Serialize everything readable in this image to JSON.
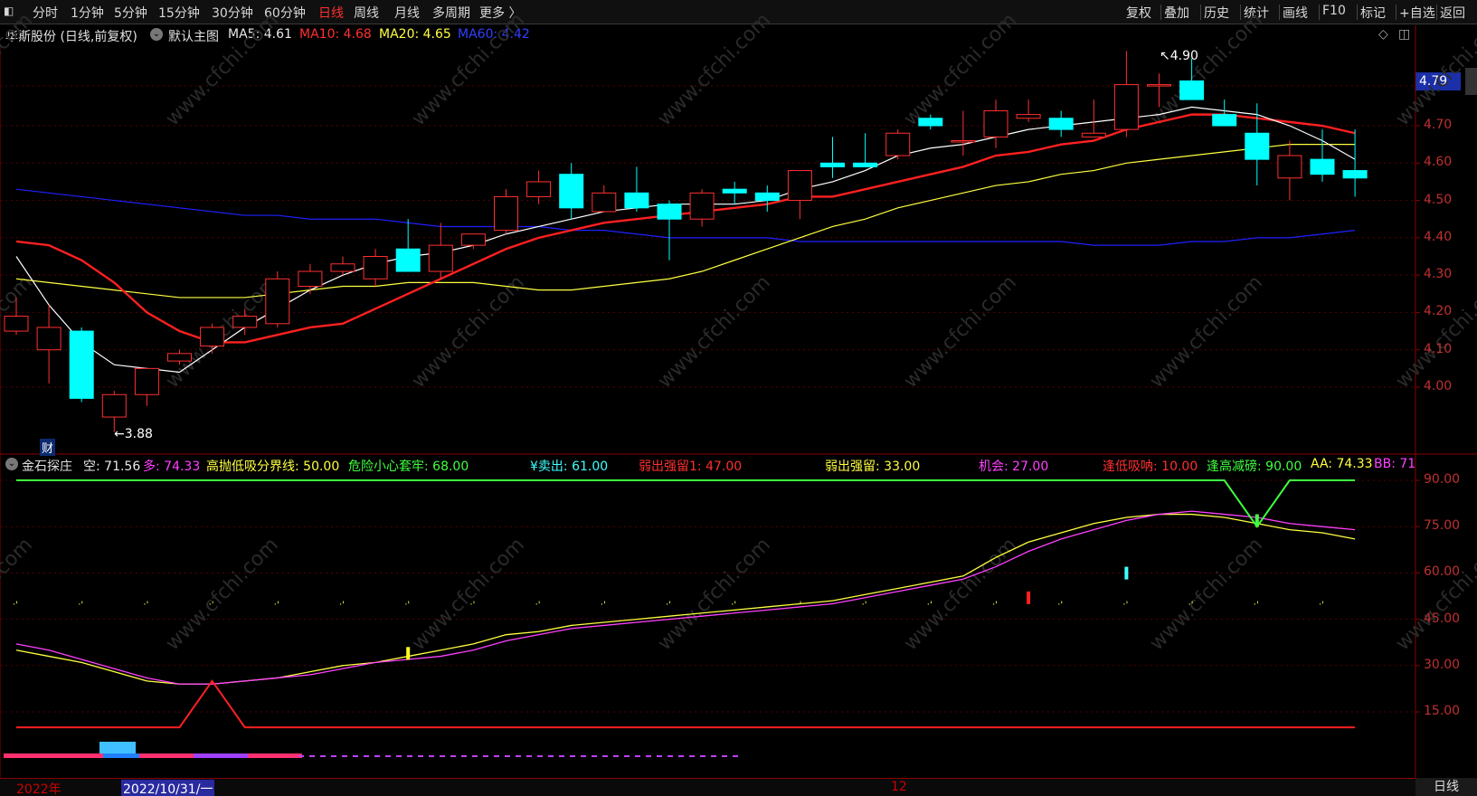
{
  "toolbar": {
    "left_items": [
      "分时",
      "1分钟",
      "5分钟",
      "15分钟",
      "30分钟",
      "60分钟",
      "日线",
      "周线",
      "月线",
      "多周期",
      "更多 〉"
    ],
    "active_item": "日线",
    "right_items": [
      "复权",
      "叠加",
      "历史",
      "统计",
      "画线",
      "F10",
      "标记",
      "+自选",
      "返回"
    ]
  },
  "main_chart": {
    "stock_title": "华斯股份 (日线,前复权)",
    "template_label": "默认主图",
    "ma5": "MA5: 4.61",
    "ma10": "MA10: 4.68",
    "ma20": "MA20: 4.65",
    "ma60": "MA60: 4.42",
    "current_price": "4.79",
    "high_marker": "4.90",
    "low_marker": "←3.88",
    "finance_marker": "财",
    "y_ticks": [
      "4.70",
      "4.60",
      "4.50",
      "4.40",
      "4.30",
      "4.20",
      "4.10",
      "4.00"
    ],
    "colors": {
      "ma5": "#ffffff",
      "ma10": "#ff2020",
      "ma20": "#ffff40",
      "ma60": "#2020ff",
      "up": "#ff3030",
      "down": "#00ffff"
    }
  },
  "indicator": {
    "name": "金石探庄",
    "kong": "空: 71.56",
    "duo": "多: 74.33",
    "line1": "高抛低吸分界线: 50.00",
    "line2": "危险小心套牢: 68.00",
    "line3": "¥卖出: 61.00",
    "line4": "弱出强留1: 47.00",
    "line5": "弱出强留: 33.00",
    "line6": "机会: 27.00",
    "line7": "逢低吸呐: 10.00",
    "line8": "逢高减磅: 90.00",
    "line9": "AA: 74.33",
    "line10": "BB: 71",
    "y_ticks": [
      "90.00",
      "75.00",
      "60.00",
      "45.00",
      "30.00",
      "15.00"
    ]
  },
  "bottom_axis": {
    "year_label": "2022年",
    "cursor_date": "2022/10/31/一",
    "month_label": "12",
    "period_label": "日线"
  },
  "watermark": "www.cfchi.com",
  "chart_data": [
    {
      "type": "candlestick",
      "title": "华斯股份 (日线,前复权)",
      "ylim": [
        3.85,
        4.95
      ],
      "candles": [
        {
          "o": 4.15,
          "h": 4.24,
          "l": 4.14,
          "c": 4.19
        },
        {
          "o": 4.1,
          "h": 4.22,
          "l": 4.01,
          "c": 4.16
        },
        {
          "o": 4.15,
          "h": 4.16,
          "l": 3.96,
          "c": 3.97
        },
        {
          "o": 3.92,
          "h": 3.99,
          "l": 3.88,
          "c": 3.98
        },
        {
          "o": 3.98,
          "h": 4.05,
          "l": 3.95,
          "c": 4.05
        },
        {
          "o": 4.07,
          "h": 4.1,
          "l": 4.06,
          "c": 4.09
        },
        {
          "o": 4.11,
          "h": 4.17,
          "l": 4.09,
          "c": 4.16
        },
        {
          "o": 4.16,
          "h": 4.21,
          "l": 4.14,
          "c": 4.19
        },
        {
          "o": 4.17,
          "h": 4.31,
          "l": 4.16,
          "c": 4.29
        },
        {
          "o": 4.27,
          "h": 4.33,
          "l": 4.25,
          "c": 4.31
        },
        {
          "o": 4.31,
          "h": 4.35,
          "l": 4.3,
          "c": 4.33
        },
        {
          "o": 4.29,
          "h": 4.37,
          "l": 4.27,
          "c": 4.35
        },
        {
          "o": 4.37,
          "h": 4.45,
          "l": 4.31,
          "c": 4.31
        },
        {
          "o": 4.31,
          "h": 4.44,
          "l": 4.29,
          "c": 4.38
        },
        {
          "o": 4.38,
          "h": 4.41,
          "l": 4.37,
          "c": 4.41
        },
        {
          "o": 4.42,
          "h": 4.53,
          "l": 4.41,
          "c": 4.51
        },
        {
          "o": 4.51,
          "h": 4.58,
          "l": 4.49,
          "c": 4.55
        },
        {
          "o": 4.57,
          "h": 4.6,
          "l": 4.45,
          "c": 4.48
        },
        {
          "o": 4.47,
          "h": 4.54,
          "l": 4.47,
          "c": 4.52
        },
        {
          "o": 4.52,
          "h": 4.59,
          "l": 4.47,
          "c": 4.48
        },
        {
          "o": 4.49,
          "h": 4.5,
          "l": 4.34,
          "c": 4.45
        },
        {
          "o": 4.45,
          "h": 4.53,
          "l": 4.43,
          "c": 4.52
        },
        {
          "o": 4.53,
          "h": 4.55,
          "l": 4.49,
          "c": 4.52
        },
        {
          "o": 4.52,
          "h": 4.54,
          "l": 4.47,
          "c": 4.5
        },
        {
          "o": 4.5,
          "h": 4.58,
          "l": 4.45,
          "c": 4.58
        },
        {
          "o": 4.6,
          "h": 4.67,
          "l": 4.56,
          "c": 4.59
        },
        {
          "o": 4.6,
          "h": 4.68,
          "l": 4.59,
          "c": 4.59
        },
        {
          "o": 4.62,
          "h": 4.69,
          "l": 4.61,
          "c": 4.68
        },
        {
          "o": 4.72,
          "h": 4.73,
          "l": 4.69,
          "c": 4.7
        },
        {
          "o": 4.66,
          "h": 4.74,
          "l": 4.62,
          "c": 4.66
        },
        {
          "o": 4.67,
          "h": 4.77,
          "l": 4.64,
          "c": 4.74
        },
        {
          "o": 4.72,
          "h": 4.77,
          "l": 4.71,
          "c": 4.73
        },
        {
          "o": 4.72,
          "h": 4.74,
          "l": 4.67,
          "c": 4.69
        },
        {
          "o": 4.67,
          "h": 4.77,
          "l": 4.67,
          "c": 4.68
        },
        {
          "o": 4.69,
          "h": 4.9,
          "l": 4.67,
          "c": 4.81
        },
        {
          "o": 4.81,
          "h": 4.84,
          "l": 4.75,
          "c": 4.81
        },
        {
          "o": 4.82,
          "h": 4.88,
          "l": 4.77,
          "c": 4.77
        },
        {
          "o": 4.73,
          "h": 4.77,
          "l": 4.7,
          "c": 4.7
        },
        {
          "o": 4.68,
          "h": 4.76,
          "l": 4.54,
          "c": 4.61
        },
        {
          "o": 4.56,
          "h": 4.66,
          "l": 4.5,
          "c": 4.62
        },
        {
          "o": 4.61,
          "h": 4.69,
          "l": 4.55,
          "c": 4.57
        },
        {
          "o": 4.58,
          "h": 4.69,
          "l": 4.51,
          "c": 4.56
        }
      ],
      "ma5": [
        4.35,
        4.22,
        4.12,
        4.06,
        4.05,
        4.04,
        4.1,
        4.16,
        4.21,
        4.26,
        4.3,
        4.33,
        4.35,
        4.36,
        4.38,
        4.41,
        4.43,
        4.45,
        4.47,
        4.48,
        4.49,
        4.49,
        4.49,
        4.5,
        4.53,
        4.55,
        4.58,
        4.62,
        4.64,
        4.65,
        4.67,
        4.69,
        4.7,
        4.71,
        4.72,
        4.73,
        4.75,
        4.74,
        4.73,
        4.7,
        4.66,
        4.61
      ],
      "ma10": [
        4.39,
        4.38,
        4.34,
        4.28,
        4.2,
        4.15,
        4.12,
        4.12,
        4.14,
        4.16,
        4.17,
        4.21,
        4.25,
        4.29,
        4.33,
        4.37,
        4.4,
        4.42,
        4.44,
        4.45,
        4.46,
        4.47,
        4.48,
        4.49,
        4.51,
        4.51,
        4.53,
        4.55,
        4.57,
        4.59,
        4.62,
        4.63,
        4.65,
        4.66,
        4.69,
        4.71,
        4.73,
        4.73,
        4.72,
        4.71,
        4.7,
        4.68
      ],
      "ma20": [
        4.29,
        4.28,
        4.27,
        4.26,
        4.25,
        4.24,
        4.24,
        4.24,
        4.25,
        4.26,
        4.27,
        4.27,
        4.28,
        4.28,
        4.28,
        4.27,
        4.26,
        4.26,
        4.27,
        4.28,
        4.29,
        4.31,
        4.34,
        4.37,
        4.4,
        4.43,
        4.45,
        4.48,
        4.5,
        4.52,
        4.54,
        4.55,
        4.57,
        4.58,
        4.6,
        4.61,
        4.62,
        4.63,
        4.64,
        4.65,
        4.65,
        4.65
      ],
      "ma60": [
        4.53,
        4.52,
        4.51,
        4.5,
        4.49,
        4.48,
        4.47,
        4.46,
        4.46,
        4.45,
        4.45,
        4.45,
        4.44,
        4.43,
        4.43,
        4.43,
        4.43,
        4.42,
        4.42,
        4.41,
        4.4,
        4.4,
        4.4,
        4.4,
        4.39,
        4.39,
        4.39,
        4.39,
        4.39,
        4.39,
        4.39,
        4.39,
        4.39,
        4.38,
        4.38,
        4.38,
        4.39,
        4.39,
        4.4,
        4.4,
        4.41,
        4.42
      ]
    },
    {
      "type": "line",
      "title": "金石探庄",
      "ylim": [
        0,
        95
      ],
      "series": [
        {
          "name": "AA",
          "values": [
            35,
            33,
            31,
            28,
            25,
            24,
            24,
            25,
            26,
            28,
            30,
            31,
            33,
            35,
            37,
            40,
            41,
            43,
            44,
            45,
            46,
            47,
            48,
            49,
            50,
            51,
            53,
            55,
            57,
            59,
            65,
            70,
            73,
            76,
            78,
            79,
            79,
            78,
            76,
            74,
            73,
            71
          ]
        },
        {
          "name": "BB",
          "values": [
            37,
            35,
            32,
            29,
            26,
            24,
            24,
            25,
            26,
            27,
            29,
            31,
            32,
            33,
            35,
            38,
            40,
            42,
            43,
            44,
            45,
            46,
            47,
            48,
            49,
            50,
            52,
            54,
            56,
            58,
            62,
            67,
            71,
            74,
            77,
            79,
            80,
            79,
            78,
            76,
            75,
            74
          ]
        },
        {
          "name": "逢低吸呐",
          "values": [
            10,
            10,
            10,
            10,
            10,
            10,
            25,
            10,
            10,
            10,
            10,
            10,
            10,
            10,
            10,
            10,
            10,
            10,
            10,
            10,
            10,
            10,
            10,
            10,
            10,
            10,
            10,
            10,
            10,
            10,
            10,
            10,
            10,
            10,
            10,
            10,
            10,
            10,
            10,
            10,
            10,
            10
          ]
        },
        {
          "name": "逢高减磅",
          "values": [
            90,
            90,
            90,
            90,
            90,
            90,
            90,
            90,
            90,
            90,
            90,
            90,
            90,
            90,
            90,
            90,
            90,
            90,
            90,
            90,
            90,
            90,
            90,
            90,
            90,
            90,
            90,
            90,
            90,
            90,
            90,
            90,
            90,
            90,
            90,
            90,
            90,
            90,
            75,
            90,
            90,
            90
          ]
        }
      ]
    }
  ]
}
